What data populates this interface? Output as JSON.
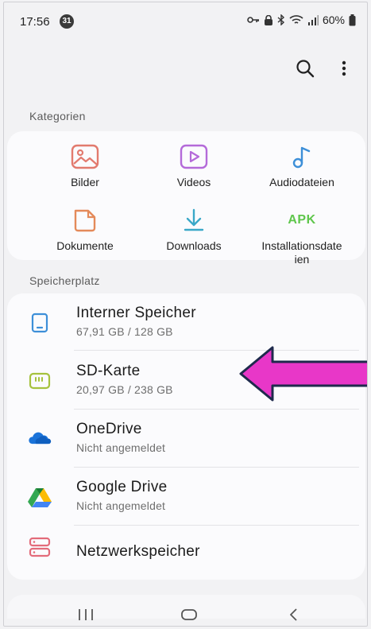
{
  "status_bar": {
    "time": "17:56",
    "notification_count": "31",
    "battery": "60%"
  },
  "sections": {
    "categories_title": "Kategorien",
    "storage_title": "Speicherplatz"
  },
  "categories": [
    {
      "label": "Bilder",
      "icon": "image-icon",
      "color": "#e27a6e"
    },
    {
      "label": "Videos",
      "icon": "video-icon",
      "color": "#b46ad9"
    },
    {
      "label": "Audiodateien",
      "icon": "music-note-icon",
      "color": "#3d8fd8"
    },
    {
      "label": "Dokumente",
      "icon": "document-icon",
      "color": "#e48a5a"
    },
    {
      "label": "Downloads",
      "icon": "download-icon",
      "color": "#3aa8c8"
    },
    {
      "label_line1": "Installationsdate",
      "label_line2": "ien",
      "icon_text": "APK",
      "icon": "apk-icon",
      "color": "#5fc64c"
    }
  ],
  "storage": [
    {
      "title": "Interner Speicher",
      "subtitle": "67,91 GB / 128 GB",
      "icon": "phone-storage-icon",
      "color": "#3d8fd8"
    },
    {
      "title": "SD-Karte",
      "subtitle": "20,97 GB / 238 GB",
      "icon": "sd-card-icon",
      "color": "#a6c23e"
    },
    {
      "title": "OneDrive",
      "subtitle": "Nicht angemeldet",
      "icon": "onedrive-icon",
      "color": "#1a73d9"
    },
    {
      "title": "Google Drive",
      "subtitle": "Nicht angemeldet",
      "icon": "google-drive-icon",
      "color": "#34a853"
    },
    {
      "title": "Netzwerkspeicher",
      "subtitle": "",
      "icon": "network-storage-icon",
      "color": "#e36b7a"
    }
  ],
  "annotation": {
    "color": "#e837c8",
    "points_to": "SD-Karte"
  }
}
